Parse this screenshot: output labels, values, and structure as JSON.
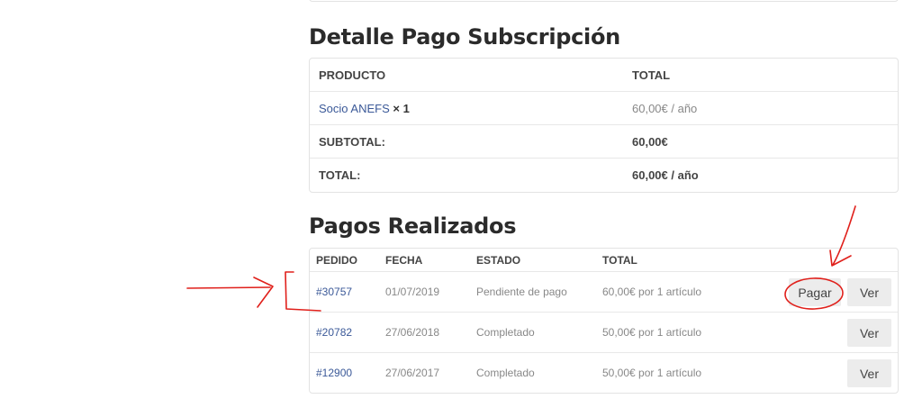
{
  "detail": {
    "title": "Detalle Pago Subscripción",
    "col_product": "PRODUCTO",
    "col_total": "TOTAL",
    "product_name": "Socio ANEFS",
    "product_qty": "× 1",
    "product_total": "60,00€ / año",
    "subtotal_label": "SUBTOTAL:",
    "subtotal_value": "60,00€",
    "total_label": "TOTAL:",
    "total_value": "60,00€ / año"
  },
  "orders": {
    "title": "Pagos Realizados",
    "headers": [
      "PEDIDO",
      "FECHA",
      "ESTADO",
      "TOTAL"
    ],
    "rows": [
      {
        "pedido": "#30757",
        "fecha": "01/07/2019",
        "estado": "Pendiente de pago",
        "total": "60,00€ por 1 artículo",
        "pay_label": "Pagar",
        "view_label": "Ver"
      },
      {
        "pedido": "#20782",
        "fecha": "27/06/2018",
        "estado": "Completado",
        "total": "50,00€ por 1 artículo",
        "view_label": "Ver"
      },
      {
        "pedido": "#12900",
        "fecha": "27/06/2017",
        "estado": "Completado",
        "total": "50,00€ por 1 artículo",
        "view_label": "Ver"
      }
    ]
  },
  "colors": {
    "link": "#3b5998",
    "annotation": "#e0201b",
    "button_bg": "#ececec"
  }
}
